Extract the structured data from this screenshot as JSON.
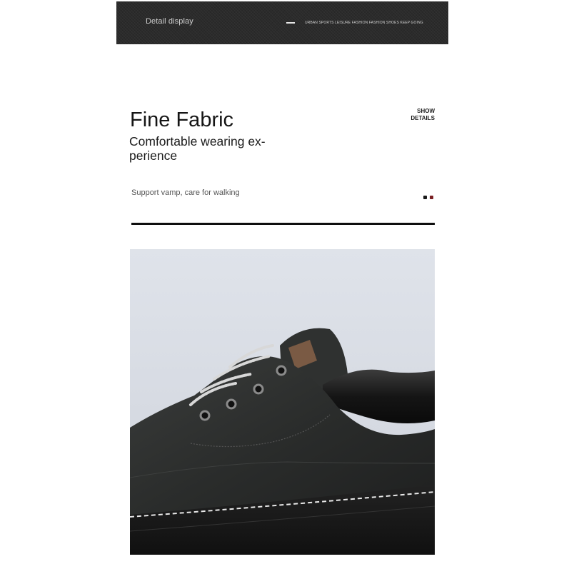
{
  "banner": {
    "title": "Detail display",
    "tagline": "URBAN SPORTS LEISURE FASHION FASHION SHOES KEEP GOING"
  },
  "product": {
    "heading": "Fine Fabric",
    "subheading_line1": "Comfortable wearing ex-",
    "subheading_line2": "perience",
    "show_label": "SHOW",
    "details_label": "DETAILS",
    "tagline": "Support vamp, care for walking"
  },
  "swatches": [
    {
      "name": "black",
      "color": "#1a1a1a"
    },
    {
      "name": "burgundy",
      "color": "#7a1f22"
    }
  ],
  "colors": {
    "banner_bg": "#2b2b2b",
    "divider": "#0f0f0f"
  }
}
